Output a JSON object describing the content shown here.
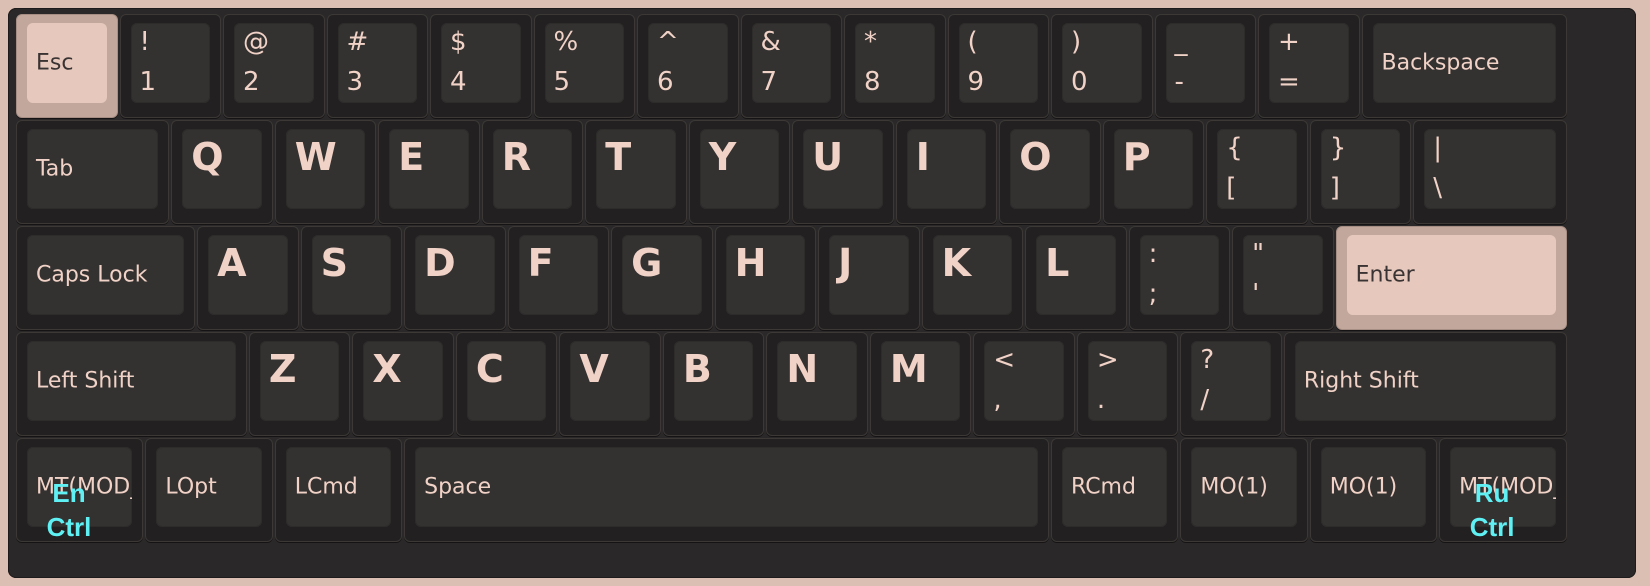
{
  "keyboard": {
    "rows": [
      [
        {
          "id": "esc",
          "label": "Esc",
          "accent": true
        },
        {
          "id": "1",
          "top": "!",
          "bottom": "1"
        },
        {
          "id": "2",
          "top": "@",
          "bottom": "2"
        },
        {
          "id": "3",
          "top": "#",
          "bottom": "3"
        },
        {
          "id": "4",
          "top": "$",
          "bottom": "4"
        },
        {
          "id": "5",
          "top": "%",
          "bottom": "5"
        },
        {
          "id": "6",
          "top": "^",
          "bottom": "6"
        },
        {
          "id": "7",
          "top": "&",
          "bottom": "7"
        },
        {
          "id": "8",
          "top": "*",
          "bottom": "8"
        },
        {
          "id": "9",
          "top": "(",
          "bottom": "9"
        },
        {
          "id": "0",
          "top": ")",
          "bottom": "0"
        },
        {
          "id": "minus",
          "top": "_",
          "bottom": "-"
        },
        {
          "id": "equal",
          "top": "+",
          "bottom": "="
        },
        {
          "id": "backspace",
          "label": "Backspace"
        }
      ],
      [
        {
          "id": "tab",
          "label": "Tab"
        },
        {
          "id": "q",
          "big": "Q"
        },
        {
          "id": "w",
          "big": "W"
        },
        {
          "id": "e",
          "big": "E"
        },
        {
          "id": "r",
          "big": "R"
        },
        {
          "id": "t",
          "big": "T"
        },
        {
          "id": "y",
          "big": "Y"
        },
        {
          "id": "u",
          "big": "U"
        },
        {
          "id": "i",
          "big": "I"
        },
        {
          "id": "o",
          "big": "O"
        },
        {
          "id": "p",
          "big": "P"
        },
        {
          "id": "lbracket",
          "top": "{",
          "bottom": "["
        },
        {
          "id": "rbracket",
          "top": "}",
          "bottom": "]"
        },
        {
          "id": "backslash",
          "top": "|",
          "bottom": "\\"
        }
      ],
      [
        {
          "id": "capslock",
          "label": "Caps Lock"
        },
        {
          "id": "a",
          "big": "A"
        },
        {
          "id": "s",
          "big": "S"
        },
        {
          "id": "d",
          "big": "D"
        },
        {
          "id": "f",
          "big": "F"
        },
        {
          "id": "g",
          "big": "G"
        },
        {
          "id": "h",
          "big": "H"
        },
        {
          "id": "j",
          "big": "J"
        },
        {
          "id": "k",
          "big": "K"
        },
        {
          "id": "l",
          "big": "L"
        },
        {
          "id": "semicolon",
          "top": ":",
          "bottom": ";"
        },
        {
          "id": "quote",
          "top": "\"",
          "bottom": "'"
        },
        {
          "id": "enter",
          "label": "Enter",
          "accent": true
        }
      ],
      [
        {
          "id": "lshift",
          "label": "Left Shift"
        },
        {
          "id": "z",
          "big": "Z"
        },
        {
          "id": "x",
          "big": "X"
        },
        {
          "id": "c",
          "big": "C"
        },
        {
          "id": "v",
          "big": "V"
        },
        {
          "id": "b",
          "big": "B"
        },
        {
          "id": "n",
          "big": "N"
        },
        {
          "id": "m",
          "big": "M"
        },
        {
          "id": "comma",
          "top": "<",
          "bottom": ","
        },
        {
          "id": "period",
          "top": ">",
          "bottom": "."
        },
        {
          "id": "slash",
          "top": "?",
          "bottom": "/"
        },
        {
          "id": "rshift",
          "label": "Right Shift"
        }
      ],
      [
        {
          "id": "lctrl",
          "label": "MT(MOD_",
          "hint": "En Ctrl"
        },
        {
          "id": "lopt",
          "label": "LOpt"
        },
        {
          "id": "lcmd",
          "label": "LCmd"
        },
        {
          "id": "space",
          "label": "Space"
        },
        {
          "id": "rcmd",
          "label": "RCmd"
        },
        {
          "id": "mo1a",
          "label": "MO(1)"
        },
        {
          "id": "mo1b",
          "label": "MO(1)"
        },
        {
          "id": "rctrl",
          "label": "MT(MOD_",
          "hint": "Ru Ctrl"
        }
      ]
    ]
  },
  "colors": {
    "background": "#dcbfb3",
    "keycap": "#343131",
    "legend": "#f0d2c6",
    "accent_keycap": "#e6c8bc",
    "hint": "#5ff0f4"
  }
}
